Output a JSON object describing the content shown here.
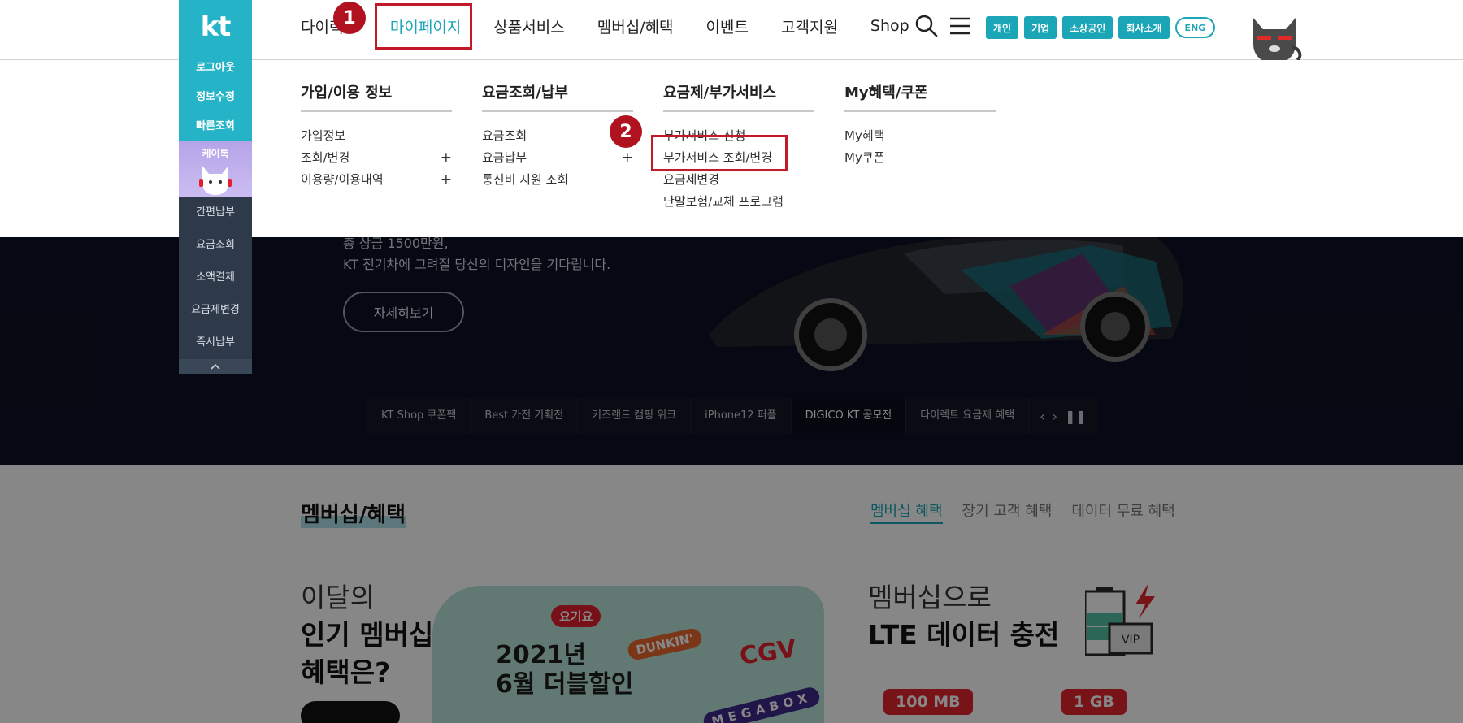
{
  "header": {
    "gnb": [
      "다이렉트",
      "마이페이지",
      "상품서비스",
      "멤버십/혜택",
      "이벤트",
      "고객지원",
      "Shop"
    ],
    "active_index": 1,
    "segments": [
      "개인",
      "기업",
      "소상공인",
      "회사소개"
    ],
    "eng": "ENG",
    "accent_color": "#1aa6b7",
    "highlight_color": "#c21a28"
  },
  "quickbar": {
    "logo": "kt",
    "top_items": [
      "로그아웃",
      "정보수정",
      "빠른조회"
    ],
    "ktalk": "케이톡",
    "items": [
      "간편납부",
      "요금조회",
      "소액결제",
      "요금제변경",
      "즉시납부"
    ]
  },
  "dropdown": {
    "columns": [
      {
        "title": "가입/이용 정보",
        "items": [
          {
            "label": "가입정보",
            "plus": ""
          },
          {
            "label": "조회/변경",
            "plus": "+"
          },
          {
            "label": "이용량/이용내역",
            "plus": "+"
          }
        ]
      },
      {
        "title": "요금조회/납부",
        "items": [
          {
            "label": "요금조회",
            "plus": ""
          },
          {
            "label": "요금납부",
            "plus": "+"
          },
          {
            "label": "통신비 지원 조회",
            "plus": ""
          }
        ]
      },
      {
        "title": "요금제/부가서비스",
        "items": [
          {
            "label": "부가서비스 신청",
            "plus": ""
          },
          {
            "label": "부가서비스 조회/변경",
            "plus": ""
          },
          {
            "label": "요금제변경",
            "plus": ""
          },
          {
            "label": "단말보험/교체 프로그램",
            "plus": ""
          }
        ]
      },
      {
        "title": "My혜택/쿠폰",
        "items": [
          {
            "label": "My혜택",
            "plus": ""
          },
          {
            "label": "My쿠폰",
            "plus": ""
          }
        ]
      }
    ]
  },
  "markers": [
    "1",
    "2"
  ],
  "hero": {
    "line1": "총 상금 1500만원,",
    "line2": "KT 전기차에 그려질 당신의 디자인을 기다립니다.",
    "button": "자세히보기",
    "tabs": [
      "KT Shop 쿠폰팩",
      "Best 가전 기획전",
      "키즈랜드 캠핑 위크",
      "iPhone12 퍼플",
      "DIGICO KT 공모전",
      "다이렉트 요금제 혜택"
    ],
    "active_tab": 4
  },
  "membership": {
    "title": "멤버십/혜택",
    "tabs": [
      "멤버십 혜택",
      "장기 고객 혜택",
      "데이터 무료 혜택"
    ],
    "popular_l1": "이달의",
    "popular_l2": "인기 멤버십",
    "popular_l3": "혜택은?",
    "banner_l1": "2021년",
    "banner_l2": "6월 더블할인",
    "banner_logos": [
      "요기요",
      "DUNKIN'",
      "CGV",
      "MEGABOX"
    ],
    "lte_l1": "멤버십으로",
    "lte_l2": "LTE 데이터 충전",
    "vip": "VIP",
    "data_options": [
      "100 MB",
      "1 GB"
    ]
  }
}
